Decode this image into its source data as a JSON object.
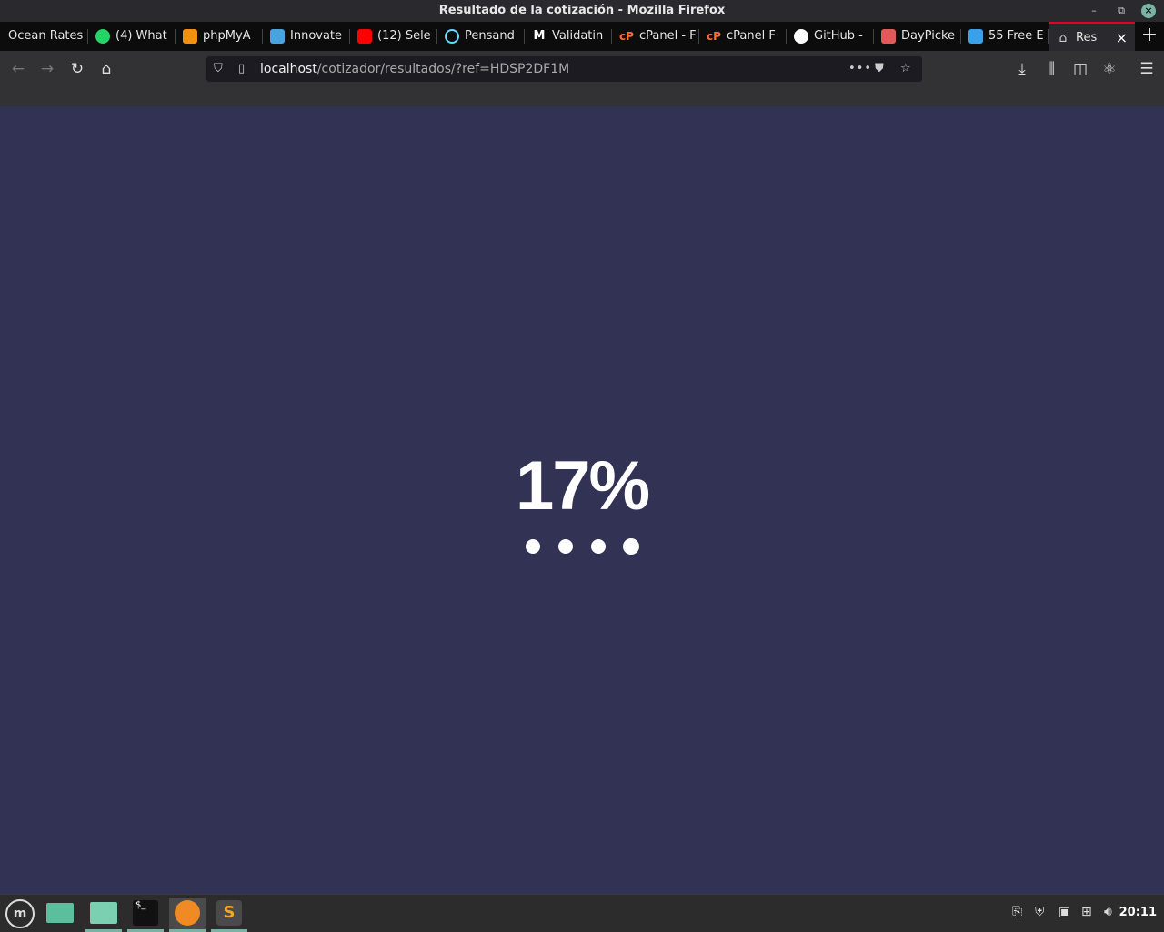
{
  "window": {
    "title": "Resultado de la cotización - Mozilla Firefox"
  },
  "tabs": [
    {
      "label": "Ocean Rates",
      "icon": "none",
      "color": ""
    },
    {
      "label": "(4) What",
      "icon": "whatsapp-icon",
      "color": "#25d366"
    },
    {
      "label": "phpMyA",
      "icon": "phpmyadmin-icon",
      "color": "#f29111"
    },
    {
      "label": "Innovate",
      "icon": "innovate-icon",
      "color": "#4aa3df"
    },
    {
      "label": "(12) Sele",
      "icon": "youtube-icon",
      "color": "#ff0000"
    },
    {
      "label": "Pensand",
      "icon": "react-icon",
      "color": "#61dafb"
    },
    {
      "label": "Validatin",
      "icon": "medium-icon",
      "color": "#ffffff"
    },
    {
      "label": "cPanel - F",
      "icon": "cpanel-icon",
      "color": "#ff6c2c"
    },
    {
      "label": "cPanel F",
      "icon": "cpanel-icon",
      "color": "#ff6c2c"
    },
    {
      "label": "GitHub -",
      "icon": "github-icon",
      "color": "#ffffff"
    },
    {
      "label": "DayPicke",
      "icon": "daypicker-icon",
      "color": "#e05a5a"
    },
    {
      "label": "55 Free E",
      "icon": "flaticon-icon",
      "color": "#3aa0e8"
    },
    {
      "label": "Res",
      "icon": "home-icon",
      "color": "#cccccc",
      "active": true
    }
  ],
  "urlbar": {
    "host": "localhost",
    "path": "/cotizador/resultados/?ref=HDSP2DF1M"
  },
  "page": {
    "progress_text": "17%",
    "progress_value": 17,
    "background": "#323254",
    "dots_count": 4
  },
  "taskbar": {
    "clock": "20:11",
    "accent": "#7ab3a6"
  }
}
